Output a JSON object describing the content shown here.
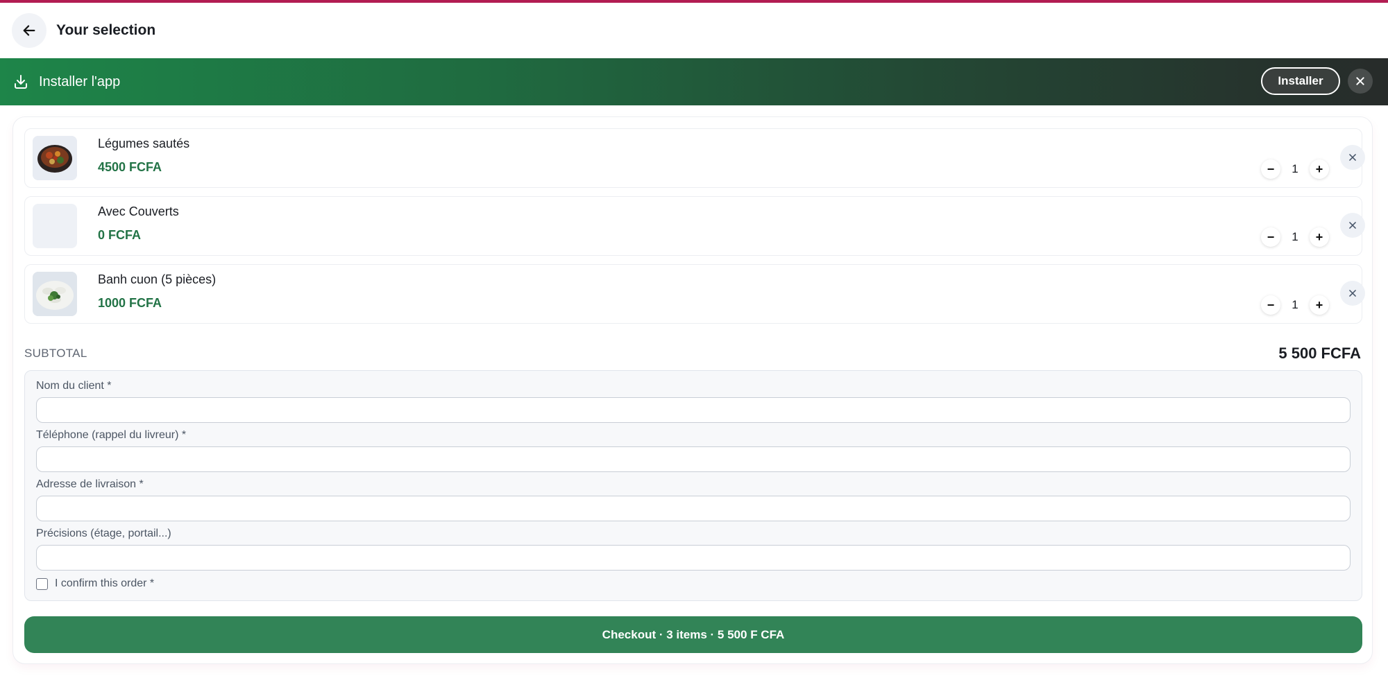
{
  "header": {
    "title": "Your selection",
    "back_icon": "arrow-left-icon"
  },
  "banner": {
    "label": "Installer l'app",
    "install_label": "Installer",
    "close_icon": "close-icon"
  },
  "colors": {
    "accent": "#b21d52",
    "price_green": "#227346",
    "checkout_green": "#328457"
  },
  "items": [
    {
      "name": "Légumes sautés",
      "price": "4500 FCFA",
      "quantity": "1",
      "image": "stir-fried-vegetables-photo"
    },
    {
      "name": "Avec Couverts",
      "price": "0 FCFA",
      "quantity": "1",
      "image": ""
    },
    {
      "name": "Banh cuon (5 pièces)",
      "price": "1000 FCFA",
      "quantity": "1",
      "image": "banh-cuon-photo"
    }
  ],
  "qty": {
    "minus": "−",
    "plus": "+"
  },
  "subtotal": {
    "label": "SUBTOTAL",
    "value": "5 500 FCFA"
  },
  "form": {
    "name_label": "Nom du client *",
    "phone_label": "Téléphone (rappel du livreur) *",
    "address_label": "Adresse de livraison *",
    "details_label": "Précisions (étage, portail...)",
    "name_value": "",
    "phone_value": "",
    "address_value": "",
    "details_value": "",
    "confirm_label": "I confirm this order *"
  },
  "checkout": {
    "label": "Checkout · 3 items · 5 500 F CFA"
  }
}
